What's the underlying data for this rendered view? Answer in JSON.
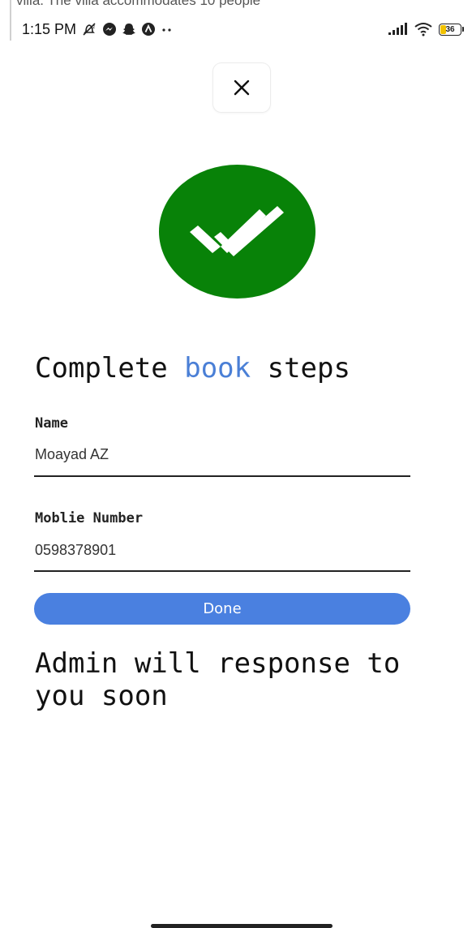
{
  "overlay": {
    "text": "villa.        The villa accommodates 10 people"
  },
  "status_bar": {
    "time": "1:15 PM",
    "left_icons": [
      "silent-mode-icon",
      "messenger-icon",
      "snapchat-icon",
      "app-a-icon",
      "more-dots-icon"
    ],
    "right_icons": [
      "cellular-signal-icon",
      "wifi-icon",
      "battery-icon"
    ],
    "battery_level": "36"
  },
  "close_button": {
    "icon": "close-icon"
  },
  "success": {
    "icon": "double-check-icon",
    "color": "#088208"
  },
  "heading": {
    "part1": "Complete ",
    "accent": "book",
    "part2": " steps",
    "accent_color": "#4a7fd6"
  },
  "form": {
    "name_label": "Name",
    "name_value": "Moayad AZ",
    "mobile_label": "Moblie Number",
    "mobile_value": "0598378901"
  },
  "done_button": {
    "label": "Done",
    "color": "#4a80e0"
  },
  "message": {
    "text": "Admin will response to you soon"
  }
}
